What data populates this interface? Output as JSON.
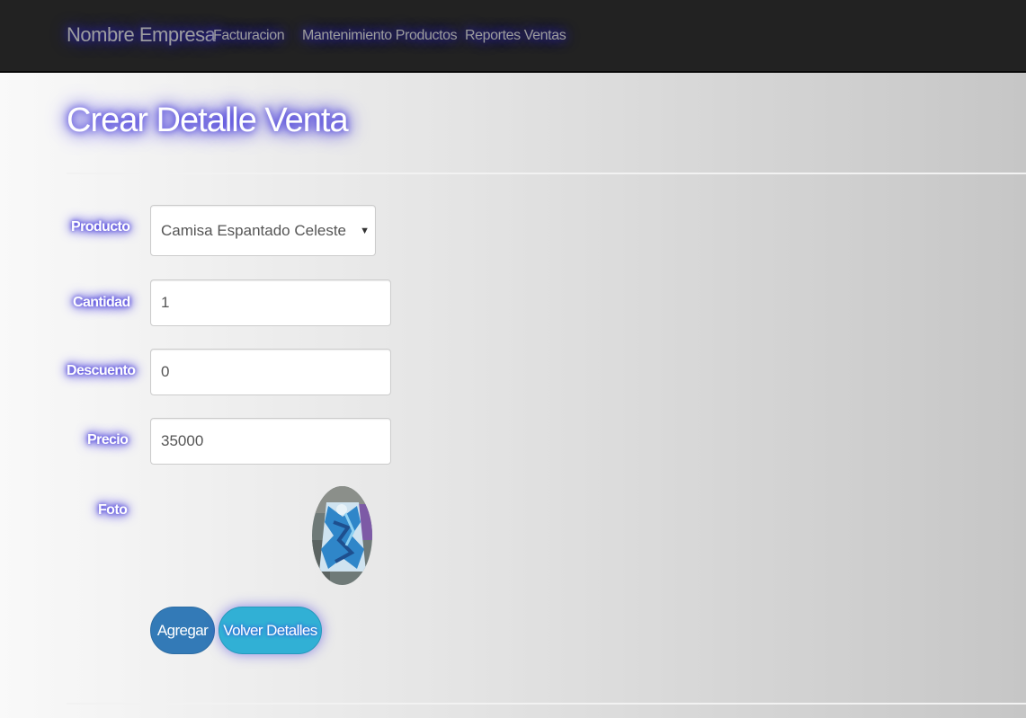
{
  "navbar": {
    "brand": "Nombre Empresa",
    "links": [
      "Facturacion",
      "Mantenimiento Productos",
      "Reportes Ventas"
    ]
  },
  "page": {
    "title": "Crear Detalle Venta"
  },
  "form": {
    "producto": {
      "label": "Producto",
      "value": "Camisa Espantado Celeste",
      "icon": "caret-down-icon"
    },
    "cantidad": {
      "label": "Cantidad",
      "value": "1"
    },
    "descuento": {
      "label": "Descuento",
      "value": "0"
    },
    "precio": {
      "label": "Precio",
      "value": "35000"
    },
    "foto": {
      "label": "Foto"
    }
  },
  "buttons": {
    "agregar": "Agregar",
    "volver": "Volver Detalles"
  },
  "colors": {
    "primary": "#337ab7",
    "info": "#31b0d5",
    "navbar": "#222222",
    "glow": "#3a2fd8"
  }
}
